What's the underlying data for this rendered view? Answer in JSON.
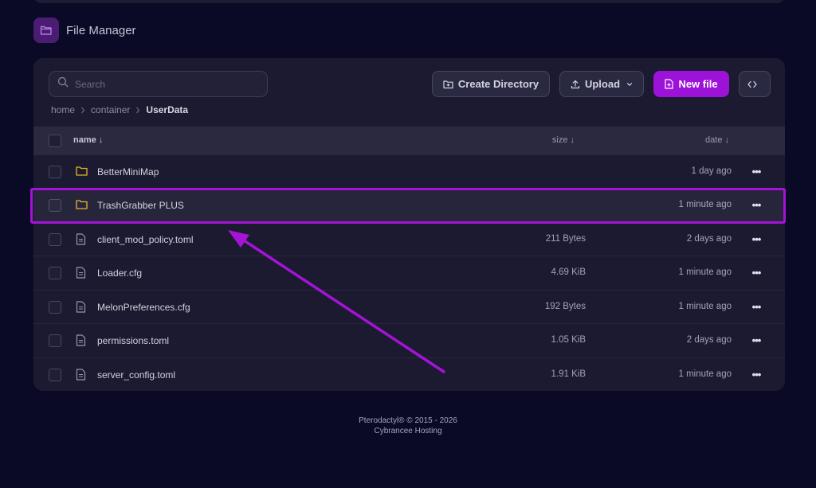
{
  "header": {
    "title": "File Manager",
    "icon": "folder-icon"
  },
  "search": {
    "placeholder": "Search",
    "value": ""
  },
  "toolbar": {
    "create_directory": "Create Directory",
    "upload": "Upload",
    "new_file": "New file"
  },
  "breadcrumb": [
    "home",
    "container",
    "UserData"
  ],
  "table": {
    "columns": {
      "name": "name ↓",
      "size": "size ↓",
      "date": "date ↓"
    },
    "rows": [
      {
        "type": "folder",
        "name": "BetterMiniMap",
        "size": "",
        "date": "1 day ago"
      },
      {
        "type": "folder",
        "name": "TrashGrabber PLUS",
        "size": "",
        "date": "1 minute ago"
      },
      {
        "type": "file",
        "name": "client_mod_policy.toml",
        "size": "211 Bytes",
        "date": "2 days ago"
      },
      {
        "type": "file",
        "name": "Loader.cfg",
        "size": "4.69 KiB",
        "date": "1 minute ago"
      },
      {
        "type": "file",
        "name": "MelonPreferences.cfg",
        "size": "192 Bytes",
        "date": "1 minute ago"
      },
      {
        "type": "file",
        "name": "permissions.toml",
        "size": "1.05 KiB",
        "date": "2 days ago"
      },
      {
        "type": "file",
        "name": "server_config.toml",
        "size": "1.91 KiB",
        "date": "1 minute ago"
      }
    ],
    "more_label": "•••"
  },
  "footer": {
    "line1": "Pterodactyl® © 2015 - 2026",
    "line2": "Cybrancee Hosting"
  },
  "colors": {
    "accent": "#9c12d8",
    "folder": "#e6b422",
    "background": "#0b0a26",
    "panel": "#1b1a31"
  }
}
